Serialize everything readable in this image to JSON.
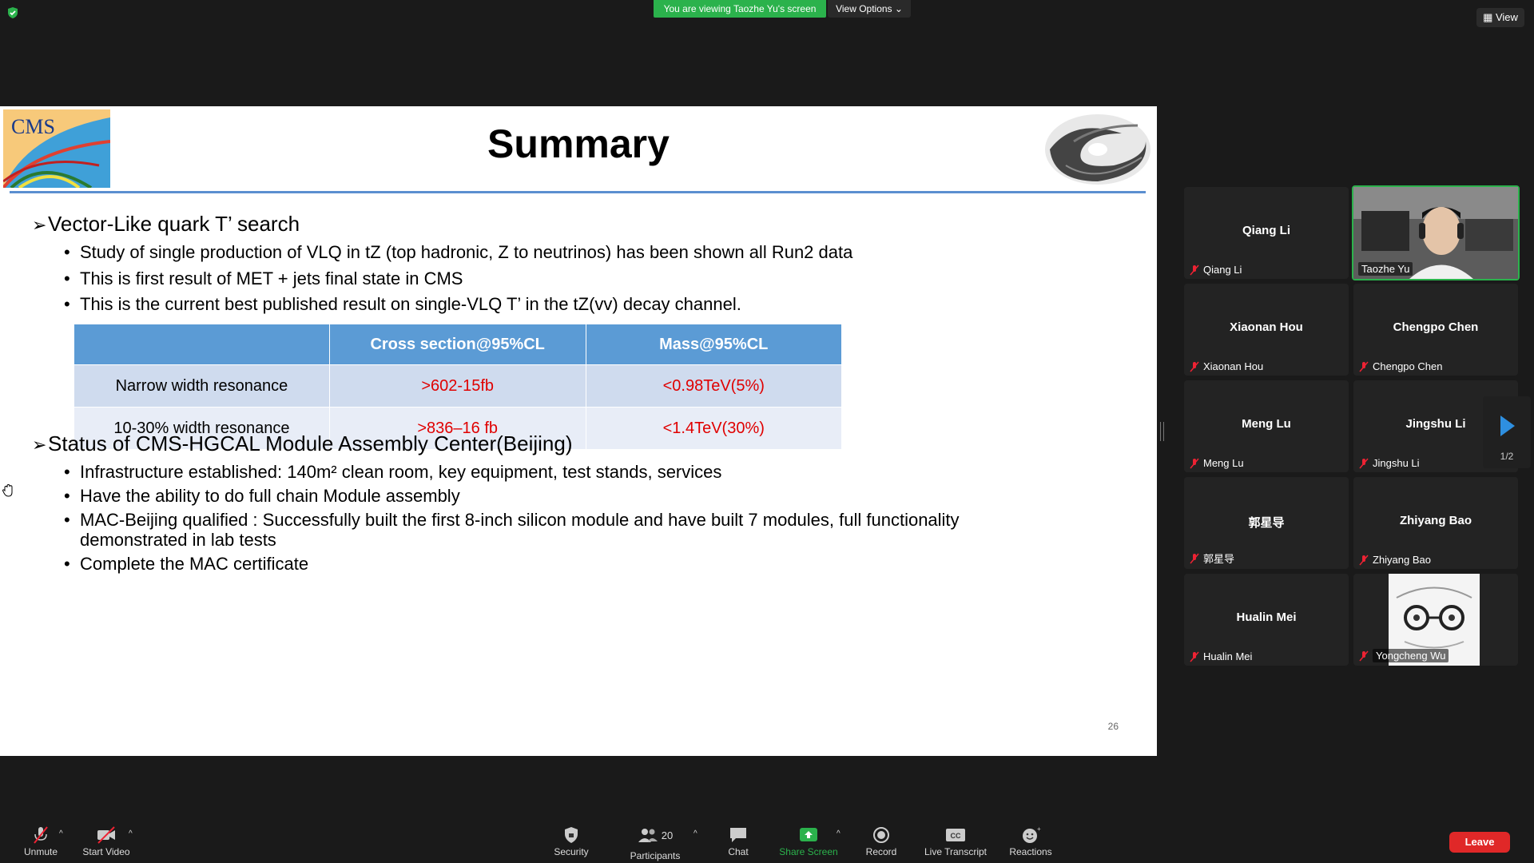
{
  "topbar": {
    "viewing_banner": "You are viewing Taozhe Yu's screen",
    "view_options": "View Options ⌄",
    "view_button": "View"
  },
  "slide": {
    "title": "Summary",
    "section1": {
      "heading": "Vector-Like quark T’ search",
      "bullets": [
        "Study of single production of VLQ in tZ (top hadronic, Z to neutrinos) has been shown all Run2 data",
        "This is first result of MET + jets final state in CMS",
        "This is the current best published result on single-VLQ T’ in the tZ(vv) decay channel."
      ]
    },
    "table": {
      "headers": [
        "",
        "Cross section@95%CL",
        "Mass@95%CL"
      ],
      "rows": [
        [
          "Narrow width resonance",
          ">602-15fb",
          "<0.98TeV(5%)"
        ],
        [
          "10-30% width resonance",
          ">836–16 fb",
          "<1.4TeV(30%)"
        ]
      ]
    },
    "section2": {
      "heading": "Status of CMS-HGCAL Module Assembly Center(Beijing)",
      "bullets": [
        "Infrastructure established: 140m² clean room, key equipment, test stands, services",
        "Have the ability to do full chain Module assembly",
        "MAC-Beijing qualified : Successfully built the first 8-inch silicon module and have built 7 modules,  full functionality demonstrated in lab tests",
        "Complete the MAC certificate"
      ]
    },
    "page_number": "26",
    "logos": {
      "left": "CMS"
    }
  },
  "participants": [
    {
      "name": "Qiang Li",
      "label": "Qiang Li"
    },
    {
      "name": "",
      "label": "Taozhe Yu"
    },
    {
      "name": "Xiaonan Hou",
      "label": "Xiaonan Hou"
    },
    {
      "name": "Chengpo Chen",
      "label": "Chengpo Chen"
    },
    {
      "name": "Meng Lu",
      "label": "Meng Lu"
    },
    {
      "name": "Jingshu Li",
      "label": "Jingshu Li"
    },
    {
      "name": "郭星导",
      "label": "郭星导"
    },
    {
      "name": "Zhiyang Bao",
      "label": "Zhiyang Bao"
    },
    {
      "name": "Hualin Mei",
      "label": "Hualin Mei"
    },
    {
      "name": "",
      "label": "Yongcheng Wu"
    }
  ],
  "gallery_page": "1/2",
  "toolbar": {
    "unmute": "Unmute",
    "start_video": "Start Video",
    "security": "Security",
    "participants": "Participants",
    "participant_count": "20",
    "chat": "Chat",
    "share_screen": "Share Screen",
    "record": "Record",
    "live_transcript": "Live Transcript",
    "reactions": "Reactions",
    "leave": "Leave"
  },
  "colors": {
    "banner_green": "#2bb24c",
    "leave_red": "#e02828",
    "table_header": "#5b9bd5",
    "value_red": "#e00000"
  }
}
